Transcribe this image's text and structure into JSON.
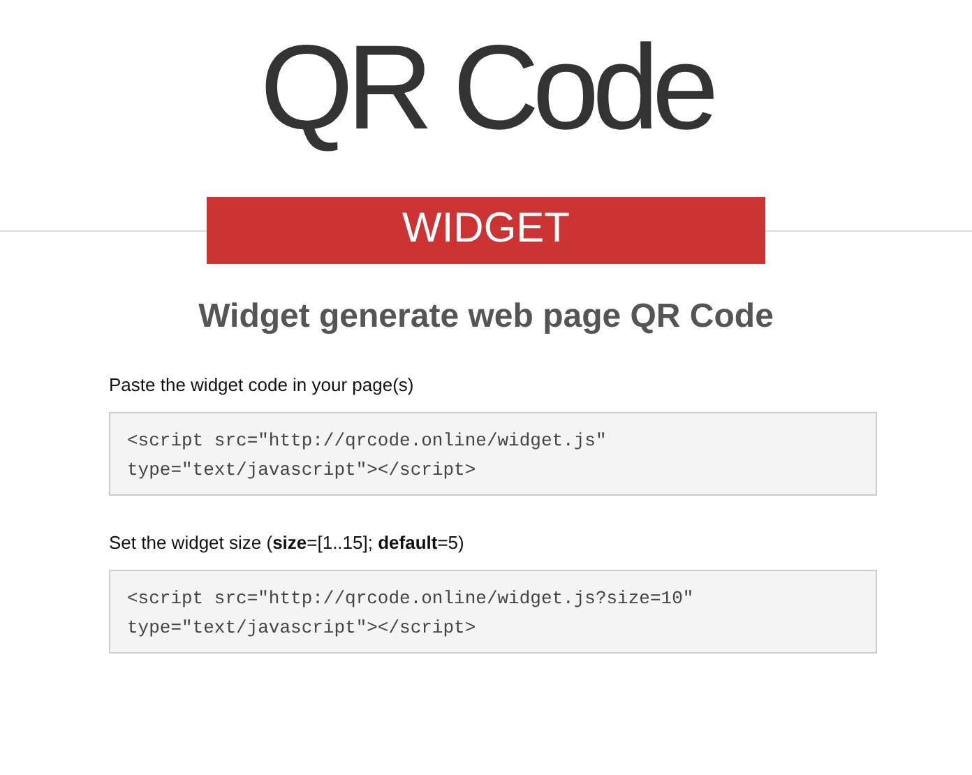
{
  "title": "QR Code",
  "banner": "WIDGET",
  "heading": "Widget generate web page QR Code",
  "sections": [
    {
      "label": "Paste the widget code in your page(s)",
      "code": [
        "<script src=\"http://qrcode.online/widget.js\"",
        "type=\"text/javascript\"></script>"
      ]
    },
    {
      "label": "Set the widget size (**size**=[1..15]; **default**=5)",
      "code": [
        "<script src=\"http://qrcode.online/widget.js?size=10\"",
        "type=\"text/javascript\"></script>"
      ]
    }
  ]
}
